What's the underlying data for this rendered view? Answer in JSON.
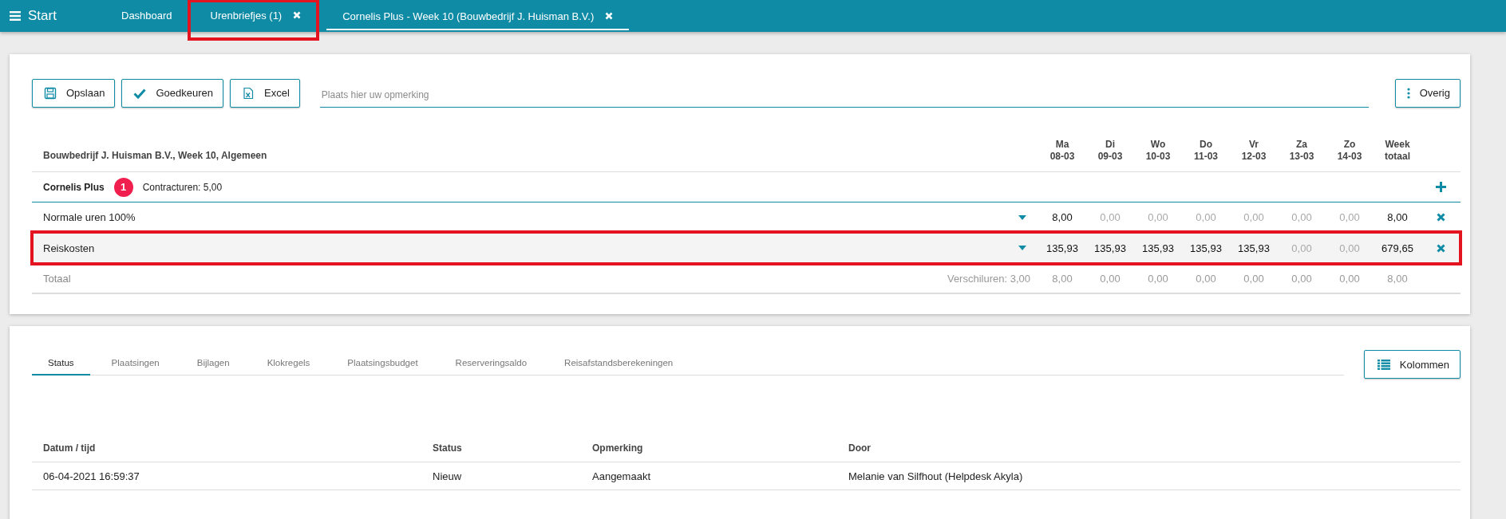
{
  "nav": {
    "menu_label": "Start",
    "tabs": [
      {
        "label": "Dashboard",
        "selected": false,
        "closable": false,
        "highlighted": false
      },
      {
        "label": "Urenbriefjes (1)",
        "selected": false,
        "closable": true,
        "highlighted": true
      },
      {
        "label": "Cornelis Plus - Week 10 (Bouwbedrijf J. Huisman B.V.)",
        "selected": true,
        "closable": true,
        "highlighted": false
      }
    ]
  },
  "toolbar": {
    "buttons": [
      {
        "label": "Opslaan",
        "kind": "save"
      },
      {
        "label": "Goedkeuren",
        "kind": "approve"
      },
      {
        "label": "Excel",
        "kind": "export"
      }
    ],
    "remark": {
      "placeholder": "Plaats hier uw opmerking"
    },
    "more_button": "Overig"
  },
  "timesheet": {
    "title": "Bouwbedrijf J. Huisman B.V., Week 10, Algemeen",
    "columns": [
      {
        "top": "Ma",
        "bottom": "08-03"
      },
      {
        "top": "Di",
        "bottom": "09-03"
      },
      {
        "top": "Wo",
        "bottom": "10-03"
      },
      {
        "top": "Do",
        "bottom": "11-03"
      },
      {
        "top": "Vr",
        "bottom": "12-03"
      },
      {
        "top": "Za",
        "bottom": "13-03"
      },
      {
        "top": "Zo",
        "bottom": "14-03"
      },
      {
        "top": "Week",
        "bottom": "totaal"
      }
    ],
    "employee": {
      "name": "Cornelis Plus",
      "badge": "1",
      "contract": "Contracturen: 5,00"
    },
    "rows": [
      {
        "label": "Normale uren 100%",
        "highlighted": false,
        "cells": [
          {
            "value": "8,00",
            "empty": false
          },
          {
            "value": "0,00",
            "empty": true
          },
          {
            "value": "0,00",
            "empty": true
          },
          {
            "value": "0,00",
            "empty": true
          },
          {
            "value": "0,00",
            "empty": true
          },
          {
            "value": "0,00",
            "empty": true
          },
          {
            "value": "0,00",
            "empty": true
          },
          {
            "value": "8,00",
            "empty": false
          }
        ]
      },
      {
        "label": "Reiskosten",
        "highlighted": true,
        "cells": [
          {
            "value": "135,93",
            "empty": false
          },
          {
            "value": "135,93",
            "empty": false
          },
          {
            "value": "135,93",
            "empty": false
          },
          {
            "value": "135,93",
            "empty": false
          },
          {
            "value": "135,93",
            "empty": false
          },
          {
            "value": "0,00",
            "empty": true
          },
          {
            "value": "0,00",
            "empty": true
          },
          {
            "value": "679,65",
            "empty": false
          }
        ]
      }
    ],
    "totals": {
      "label": "Totaal",
      "difference": "Verschiluren: 3,00",
      "cells": [
        "8,00",
        "0,00",
        "0,00",
        "0,00",
        "0,00",
        "0,00",
        "0,00",
        "8,00"
      ]
    }
  },
  "details": {
    "tabs": [
      {
        "label": "Status",
        "selected": true
      },
      {
        "label": "Plaatsingen",
        "selected": false
      },
      {
        "label": "Bijlagen",
        "selected": false
      },
      {
        "label": "Klokregels",
        "selected": false
      },
      {
        "label": "Plaatsingsbudget",
        "selected": false
      },
      {
        "label": "Reserveringsaldo",
        "selected": false
      },
      {
        "label": "Reisafstandsberekeningen",
        "selected": false
      }
    ],
    "columns_button": "Kolommen",
    "table": {
      "columns": [
        "Datum / tijd",
        "Status",
        "Opmerking",
        "Door"
      ],
      "rows": [
        [
          "06-04-2021 16:59:37",
          "Nieuw",
          "Aangemaakt",
          "Melanie van Silfhout (Helpdesk Akyla)"
        ]
      ]
    }
  }
}
